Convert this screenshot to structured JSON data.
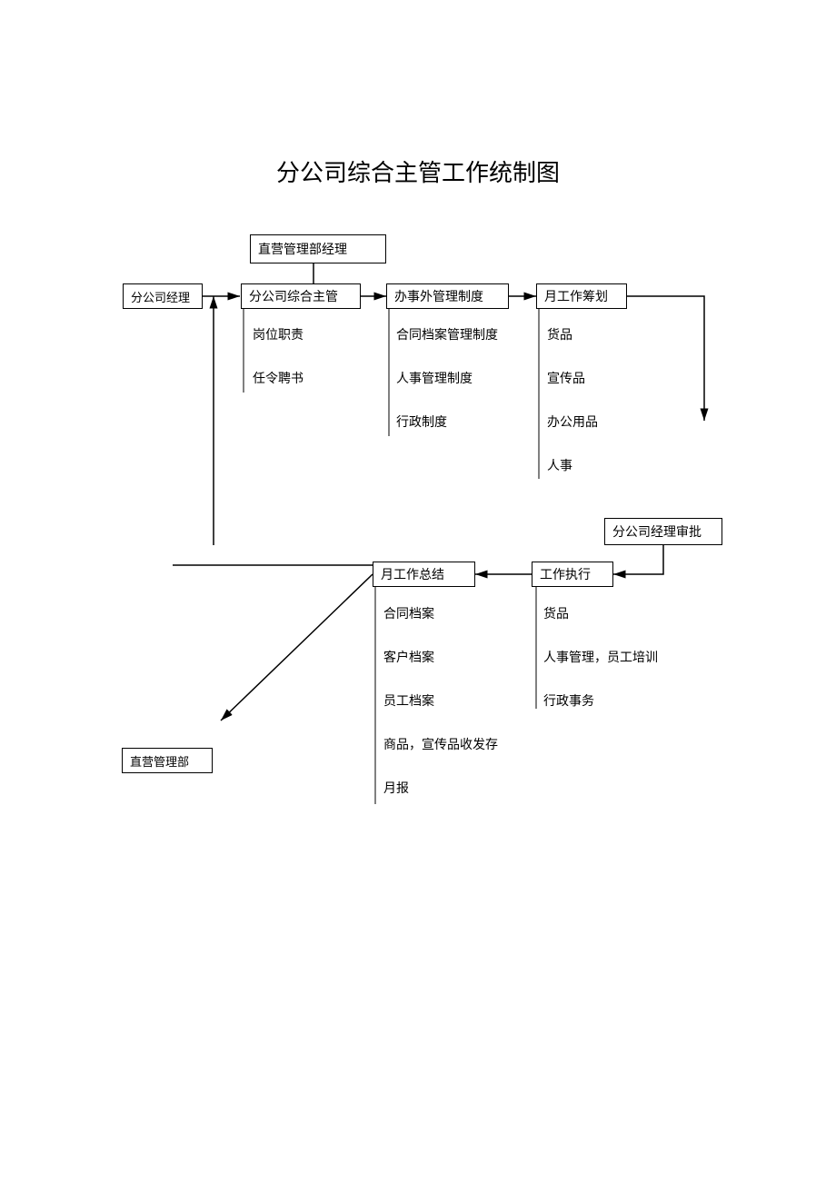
{
  "title": "分公司综合主管工作统制图",
  "nodes": {
    "direct_mgmt_top": "直营管理部经理",
    "branch_manager": "分公司经理",
    "branch_supervisor": "分公司综合主管",
    "office_mgmt": "办事外管理制度",
    "month_plan": "月工作筹划",
    "branch_manager_approve": "分公司经理审批",
    "work_exec": "工作执行",
    "month_summary": "月工作总结",
    "direct_mgmt_bottom": "直营管理部"
  },
  "sub": {
    "supervisor": {
      "a": "岗位职责",
      "b": "任令聘书"
    },
    "office": {
      "a": "合同档案管理制度",
      "b": "人事管理制度",
      "c": "行政制度"
    },
    "plan": {
      "a": "货品",
      "b": "宣传品",
      "c": "办公用品",
      "d": "人事"
    },
    "exec": {
      "a": "货品",
      "b": "人事管理，员工培训",
      "c": "行政事务"
    },
    "summary": {
      "a": "合同档案",
      "b": "客户档案",
      "c": "员工档案",
      "d": "商品，宣传品收发存",
      "e": "月报"
    }
  }
}
